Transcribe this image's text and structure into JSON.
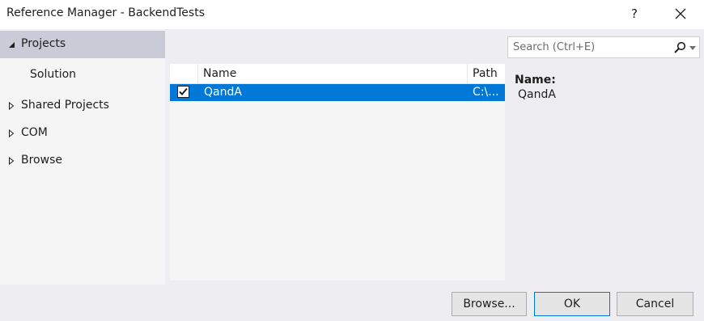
{
  "window": {
    "title": "Reference Manager - BackendTests",
    "help_label": "?"
  },
  "sidebar": {
    "items": [
      {
        "label": "Projects",
        "expanded": true,
        "selected": true
      },
      {
        "label": "Solution"
      },
      {
        "label": "Shared Projects",
        "expanded": false
      },
      {
        "label": "COM",
        "expanded": false
      },
      {
        "label": "Browse",
        "expanded": false
      }
    ]
  },
  "search": {
    "placeholder": "Search (Ctrl+E)",
    "value": "",
    "icon": "search-icon"
  },
  "grid": {
    "columns": [
      "Name",
      "Path"
    ],
    "rows": [
      {
        "checked": true,
        "selected": true,
        "name": "QandA",
        "path": "C:\\..."
      }
    ]
  },
  "details": {
    "label": "Name:",
    "value": "QandA"
  },
  "buttons": {
    "browse": "Browse...",
    "ok": "OK",
    "cancel": "Cancel"
  },
  "colors": {
    "selection": "#0078d7",
    "nav_selected": "#c9cbd6",
    "dialog_background": "#eeeef2"
  }
}
